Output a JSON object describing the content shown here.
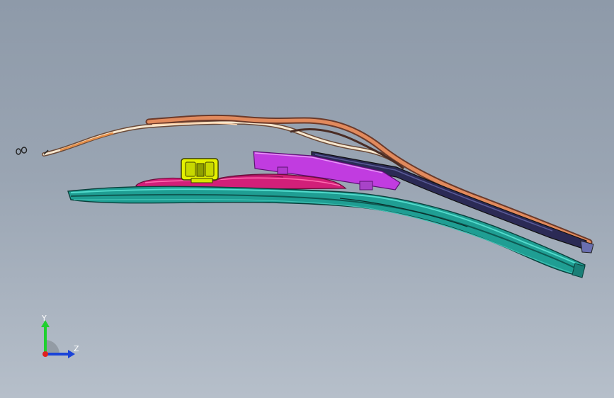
{
  "viewport": {
    "background_top": "#8e9aa9",
    "background_bottom": "#b6bfca"
  },
  "model": {
    "parts": [
      {
        "name": "wiper-spring-strip",
        "color": "#e8c09a"
      },
      {
        "name": "wiper-arm-rail",
        "color": "#c06a3c"
      },
      {
        "name": "wiper-blade-body",
        "color": "#1f9e93"
      },
      {
        "name": "spoiler-cover",
        "color": "#d21f79"
      },
      {
        "name": "connector-adapter",
        "color": "#e4f000"
      },
      {
        "name": "arm-clip",
        "color": "#c13ce0"
      },
      {
        "name": "arm-channel",
        "color": "#2b2a55"
      }
    ]
  },
  "triad": {
    "y_label": "Y",
    "z_label": "Z",
    "y_color": "#1fd02e",
    "z_color": "#1a43d8",
    "x_color": "#e0201f"
  }
}
